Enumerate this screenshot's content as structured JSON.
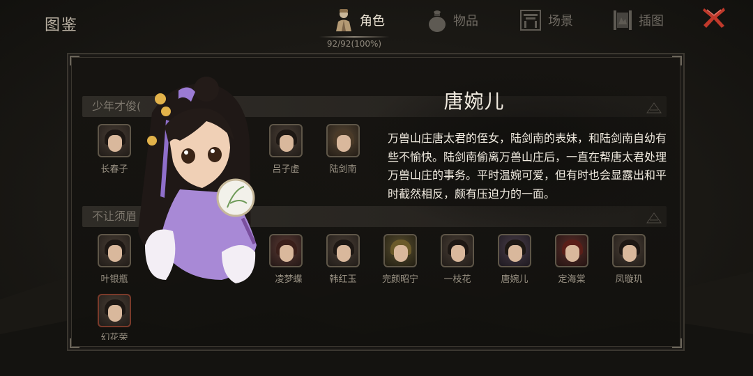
{
  "header": {
    "title": "图鉴",
    "progress": "92/92(100%)",
    "tabs": [
      {
        "label": "角色",
        "icon": "character-icon",
        "active": true
      },
      {
        "label": "物品",
        "icon": "item-bag-icon",
        "active": false
      },
      {
        "label": "场景",
        "icon": "scene-gate-icon",
        "active": false
      },
      {
        "label": "插图",
        "icon": "illustration-scroll-icon",
        "active": false
      }
    ],
    "close_icon": "close-icon"
  },
  "sections": [
    {
      "title": "少年才俊(",
      "characters": [
        "长春子",
        "",
        "",
        "吕子虚",
        "陆剑南"
      ]
    },
    {
      "title": "不让须眉",
      "characters": [
        "叶银瓶",
        "",
        "凌梦蝶",
        "韩红玉",
        "完颜昭宁",
        "一枝花",
        "唐婉儿",
        "定海棠",
        "凤璇玑",
        "幻花荣"
      ]
    }
  ],
  "selected": {
    "name": "唐婉儿",
    "description": "万兽山庄唐太君的侄女，陆剑南的表妹，和陆剑南自幼有些不愉快。陆剑南偷离万兽山庄后，一直在帮唐太君处理万兽山庄的事务。平时温婉可爱，但有时也会显露出和平时截然相反，颇有压迫力的一面。"
  },
  "colors": {
    "accent_red": "#c0392b",
    "text_light": "#f1ebe0",
    "tab_inactive": "#6f6a62",
    "frame": "#3b3730"
  }
}
